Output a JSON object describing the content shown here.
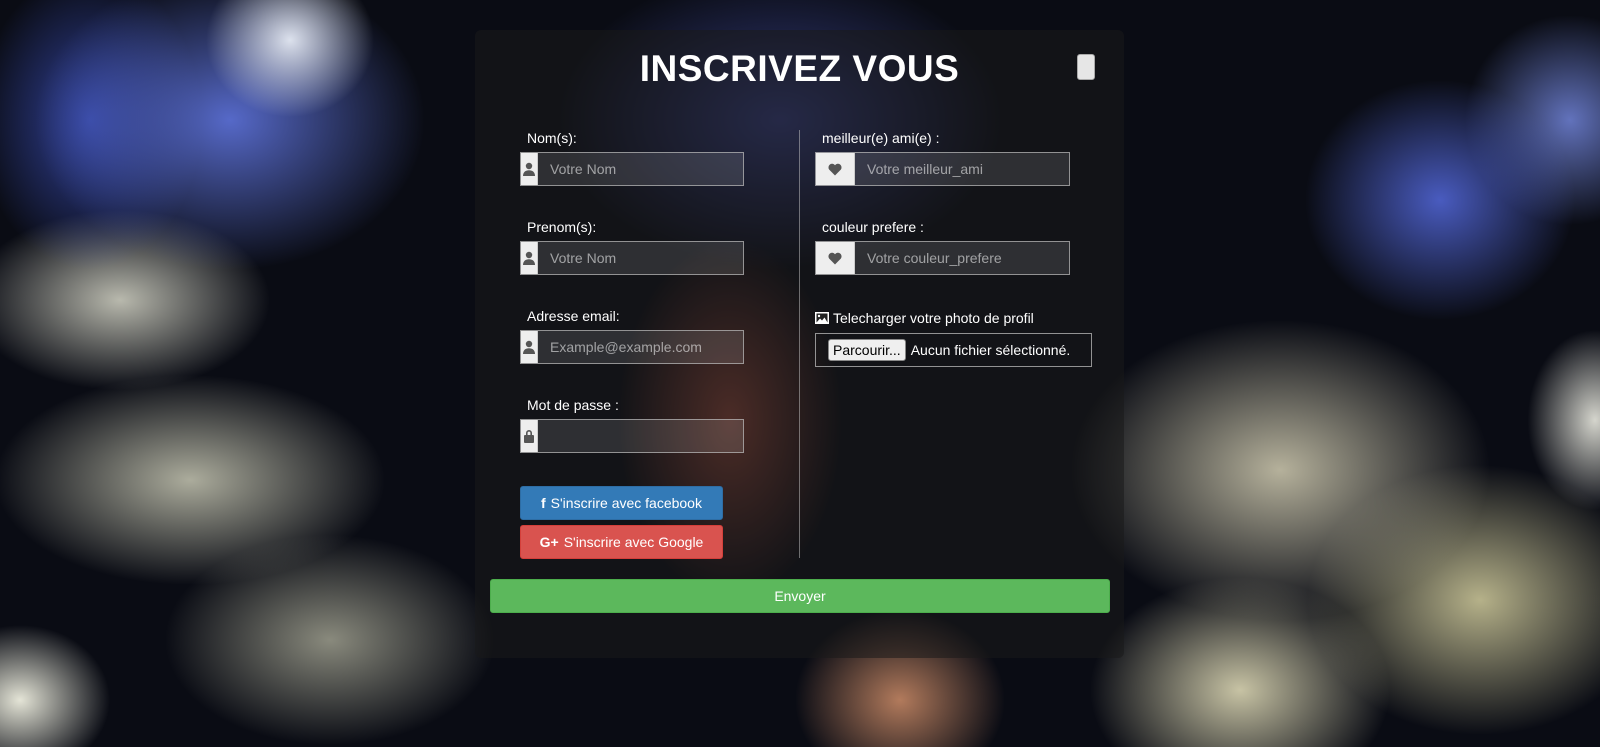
{
  "form": {
    "title": "INSCRIVEZ VOUS",
    "left_fields": [
      {
        "label": "Nom(s):",
        "placeholder": "Votre Nom",
        "icon": "user-icon",
        "type": "text"
      },
      {
        "label": "Prenom(s):",
        "placeholder": "Votre Nom",
        "icon": "user-icon",
        "type": "text"
      },
      {
        "label": "Adresse email:",
        "placeholder": "Example@example.com",
        "icon": "user-icon",
        "type": "email"
      },
      {
        "label": "Mot de passe :",
        "placeholder": "",
        "icon": "lock-icon",
        "type": "password"
      }
    ],
    "right_fields": [
      {
        "label": "meilleur(e) ami(e) :",
        "placeholder": "Votre meilleur_ami",
        "icon": "heart-icon",
        "type": "text"
      },
      {
        "label": "couleur prefere :",
        "placeholder": "Votre couleur_prefere",
        "icon": "heart-icon",
        "type": "text"
      }
    ],
    "photo": {
      "label": "Telecharger votre photo de profil",
      "icon": "picture-icon",
      "browse_label": "Parcourir...",
      "status": "Aucun fichier sélectionné."
    },
    "social": {
      "facebook_label": "S'inscrire avec facebook",
      "facebook_icon": "f",
      "google_label": "S'inscrire avec Google",
      "google_icon": "G+"
    },
    "submit_label": "Envoyer"
  },
  "colors": {
    "facebook": "#337ab7",
    "google": "#d9534f",
    "submit": "#5cb85c"
  }
}
